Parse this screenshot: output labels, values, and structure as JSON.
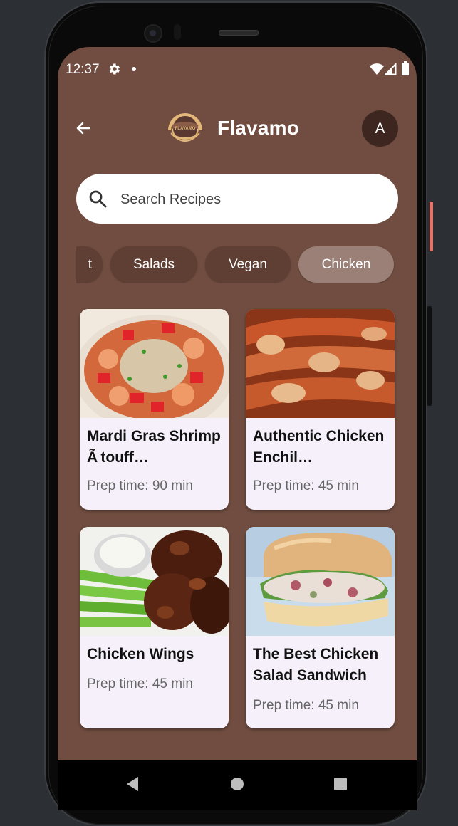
{
  "status_bar": {
    "time": "12:37"
  },
  "header": {
    "title": "Flavamo",
    "logo_text": "FLAVAMO",
    "avatar_letter": "A"
  },
  "search": {
    "placeholder": "Search Recipes"
  },
  "categories": [
    {
      "label": "t",
      "selected": false
    },
    {
      "label": "Salads",
      "selected": false
    },
    {
      "label": "Vegan",
      "selected": false
    },
    {
      "label": "Chicken",
      "selected": true
    }
  ],
  "recipes": [
    {
      "title": "Mardi Gras Shrimp Ã touff…",
      "prep": "Prep time: 90 min"
    },
    {
      "title": "Authentic Chicken Enchil…",
      "prep": "Prep time: 45 min"
    },
    {
      "title": "Chicken Wings",
      "prep": "Prep time: 45 min"
    },
    {
      "title": "The Best Chicken Salad Sandwich",
      "prep": "Prep time: 45 min"
    }
  ],
  "colors": {
    "screen_bg": "#704d40",
    "chip_bg": "#5f3e33",
    "chip_selected": "#9b8078",
    "card_bg": "#f6f0fb"
  }
}
